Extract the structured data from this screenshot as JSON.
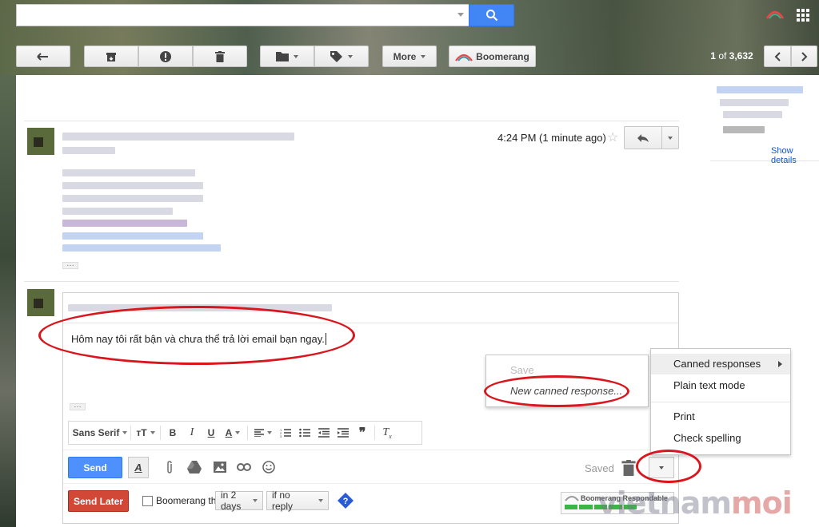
{
  "search": {
    "placeholder": ""
  },
  "toolbar": {
    "more_label": "More",
    "boomerang_label": "Boomerang",
    "pager_range": "1",
    "pager_of": "of",
    "pager_total": "3,632"
  },
  "sidebar_info": {
    "show_details_label": "Show details"
  },
  "message": {
    "time": "4:24 PM (1 minute ago)",
    "ellipsis": "…"
  },
  "compose": {
    "body_text": "Hôm nay tôi rất bận và chưa thể trả lời email bạn ngay.",
    "ellipsis": "…",
    "font_name": "Sans Serif",
    "send_label": "Send",
    "saved_label": "Saved"
  },
  "boomerang_bar": {
    "send_later_label": "Send Later",
    "boomerang_this_label": "Boomerang this",
    "delay_value": "in 2 days",
    "condition_value": "if no reply",
    "respondable_label": "Boomerang Respondable"
  },
  "canned_submenu": {
    "save_label": "Save",
    "new_label": "New canned response..."
  },
  "options_menu": {
    "items": [
      "Canned responses",
      "Plain text mode",
      "Print",
      "Check spelling"
    ]
  },
  "watermark": {
    "part1": "vietnam",
    "part2": "moi"
  },
  "colors": {
    "send_blue": "#4d90fe",
    "send_later_red": "#d14836",
    "annotation_red": "#d9161d",
    "search_blue": "#4285f4"
  }
}
